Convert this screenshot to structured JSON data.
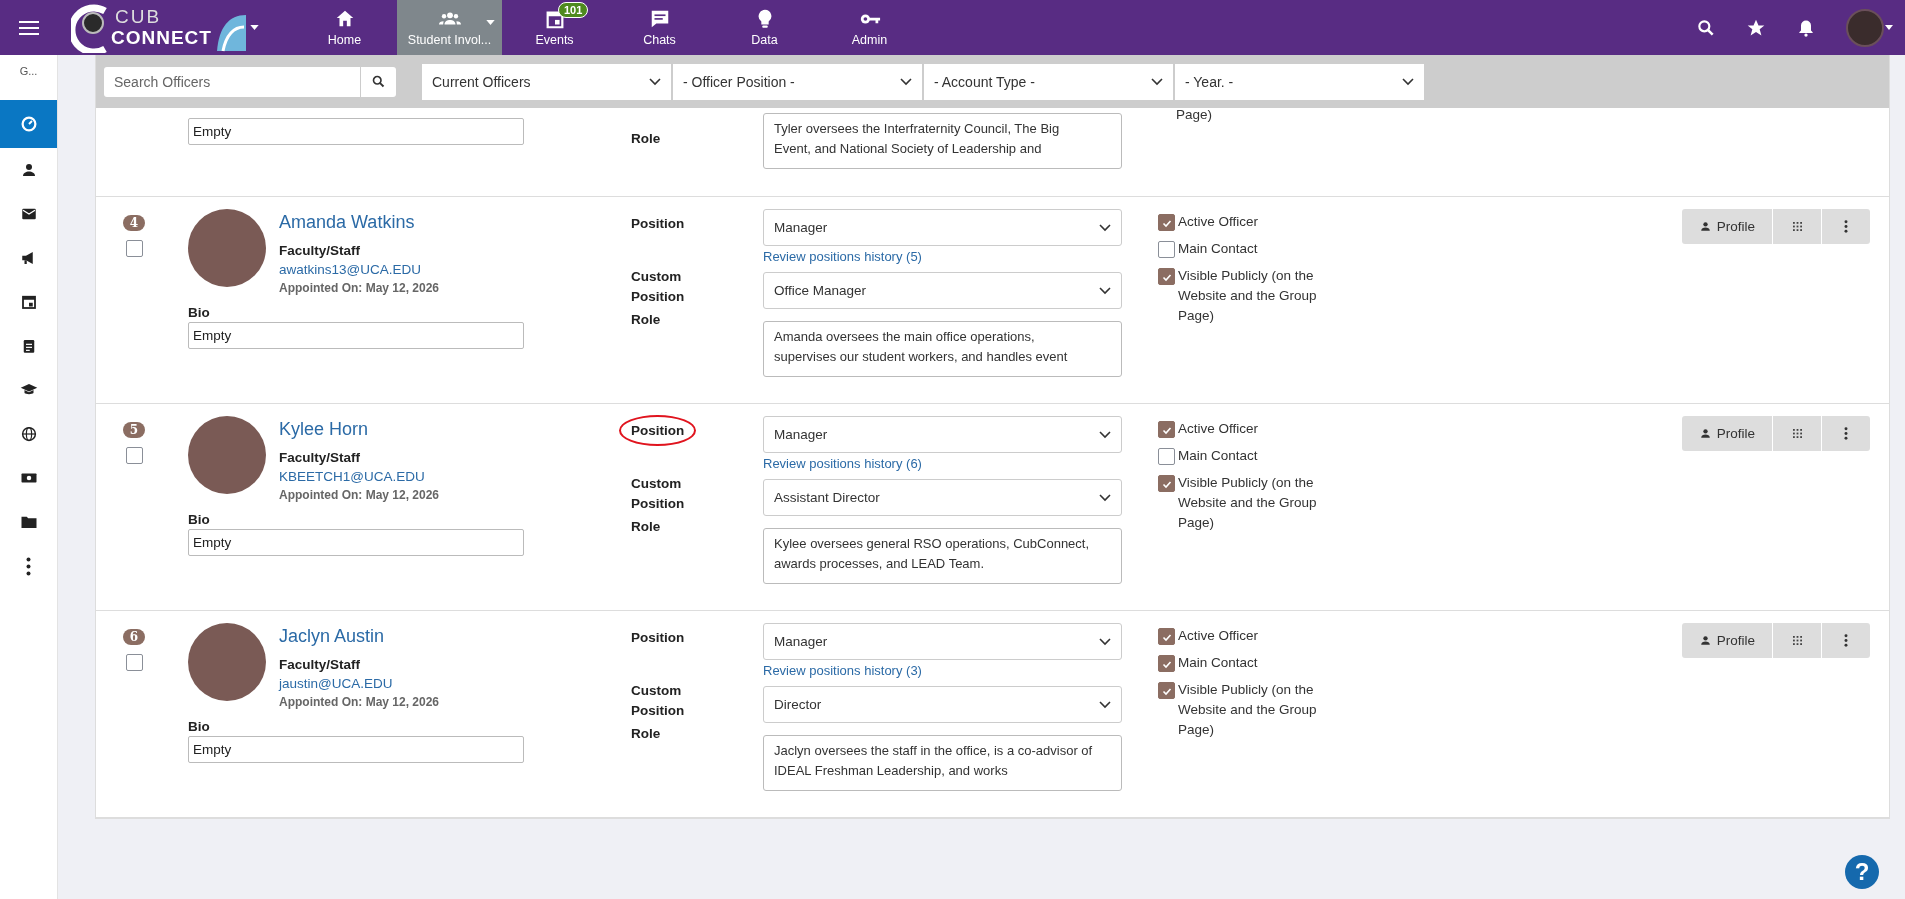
{
  "logo": {
    "line_1": "CUB",
    "line_2": "CONNECT"
  },
  "nav": [
    {
      "label": "Home",
      "selected": false
    },
    {
      "label": "Student Invol...",
      "selected": true
    },
    {
      "label": "Events",
      "selected": false,
      "badge": "101"
    },
    {
      "label": "Chats",
      "selected": false
    },
    {
      "label": "Data",
      "selected": false
    },
    {
      "label": "Admin",
      "selected": false
    }
  ],
  "sidebar": {
    "label": "G...",
    "items": [
      {
        "selected": true
      },
      {
        "selected": false
      },
      {
        "selected": false
      },
      {
        "selected": false
      },
      {
        "selected": false
      },
      {
        "selected": false
      },
      {
        "selected": false
      },
      {
        "selected": false
      },
      {
        "selected": false
      },
      {
        "selected": false
      },
      {
        "selected": false
      }
    ]
  },
  "filters": {
    "search": {
      "placeholder": "Search Officers"
    },
    "selects": [
      "Current Officers",
      "- Officer Position -",
      "- Account Type -",
      "- Year. -"
    ]
  },
  "partial_row": {
    "bio": "Empty",
    "role_label": "Role",
    "role": "Tyler oversees the Interfraternity Council, The Big Event, and National Society of Leadership and",
    "check_tail": "Page)"
  },
  "officers": [
    {
      "number": "4",
      "selected": false,
      "name": "Amanda Watkins",
      "account_type": "Faculty/Staff",
      "email": "awatkins13@UCA.EDU",
      "appointed": "Appointed On: May 12, 2026",
      "bio_label": "Bio",
      "bio": "Empty",
      "position_label": "Position",
      "position_circled": false,
      "position": "Manager",
      "history_link": "Review positions history (5)",
      "custom_label": "Custom Position",
      "custom_position": "Office Manager",
      "role_label": "Role",
      "role": "Amanda oversees the main office operations, supervises our student workers, and handles event",
      "checks": [
        {
          "label": "Active Officer",
          "checked": true
        },
        {
          "label": "Main Contact",
          "checked": false
        },
        {
          "label": "Visible Publicly (on the Website and the Group Page)",
          "checked": true
        }
      ],
      "profile_button": "Profile"
    },
    {
      "number": "5",
      "selected": false,
      "name": "Kylee Horn",
      "account_type": "Faculty/Staff",
      "email": "KBEETCH1@UCA.EDU",
      "appointed": "Appointed On: May 12, 2026",
      "bio_label": "Bio",
      "bio": "Empty",
      "position_label": "Position",
      "position_circled": true,
      "position": "Manager",
      "history_link": "Review positions history (6)",
      "custom_label": "Custom Position",
      "custom_position": "Assistant Director",
      "role_label": "Role",
      "role": "Kylee oversees general RSO operations, CubConnect, awards processes, and LEAD Team.",
      "checks": [
        {
          "label": "Active Officer",
          "checked": true
        },
        {
          "label": "Main Contact",
          "checked": false
        },
        {
          "label": "Visible Publicly (on the Website and the Group Page)",
          "checked": true
        }
      ],
      "profile_button": "Profile"
    },
    {
      "number": "6",
      "selected": false,
      "name": "Jaclyn Austin",
      "account_type": "Faculty/Staff",
      "email": "jaustin@UCA.EDU",
      "appointed": "Appointed On: May 12, 2026",
      "bio_label": "Bio",
      "bio": "Empty",
      "position_label": "Position",
      "position_circled": false,
      "position": "Manager",
      "history_link": "Review positions history (3)",
      "custom_label": "Custom Position",
      "custom_position": "Director",
      "role_label": "Role",
      "role": "Jaclyn oversees the staff in the office, is a co-advisor of IDEAL Freshman Leadership, and works",
      "checks": [
        {
          "label": "Active Officer",
          "checked": true
        },
        {
          "label": "Main Contact",
          "checked": true
        },
        {
          "label": "Visible Publicly (on the Website and the Group Page)",
          "checked": true
        }
      ],
      "profile_button": "Profile"
    }
  ],
  "help_button": "?"
}
